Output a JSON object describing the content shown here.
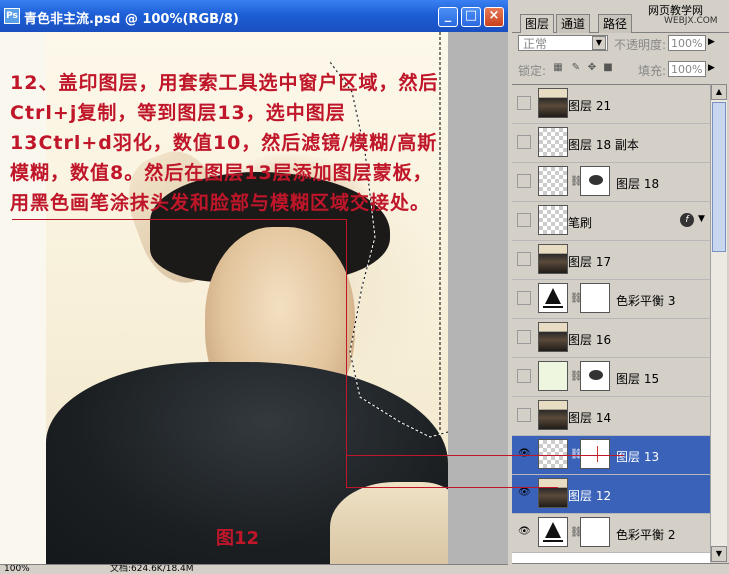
{
  "document": {
    "title": "青色非主流.psd @ 100%(RGB/8)",
    "icon": "ps-document-icon",
    "zoom": "100%",
    "doc_size": "文档:624.6K/18.4M",
    "instruction": "12、盖印图层，用套索工具选中窗户区域，然后Ctrl+j复制，等到图层13，选中图层13Ctrl+d羽化，数值10，然后滤镜/模糊/高斯模糊，数值8。然后在图层13层添加图层蒙板，用黑色画笔涂抹头发和脸部与模糊区域交接处。",
    "figure_label": "图12",
    "annotation_color": "#c0162a"
  },
  "panel": {
    "tabs": [
      "图层",
      "通道",
      "路径"
    ],
    "watermark": "网页教学网",
    "watermark_sub": "WEBJX.COM",
    "blend_mode": "正常",
    "opacity_label": "不透明度:",
    "opacity_value": "100%",
    "lock_label": "锁定:",
    "fill_label": "填充:",
    "fill_value": "100%",
    "selected_color": "#3a62b8",
    "layers": [
      {
        "name": "图层 21",
        "visible": false,
        "thumb": "photo",
        "selected": false
      },
      {
        "name": "图层 18 副本",
        "visible": false,
        "thumb": "transparent",
        "selected": false
      },
      {
        "name": "图层 18",
        "visible": false,
        "thumb": "transparent",
        "mask": "smudge",
        "selected": false
      },
      {
        "name": "笔刷",
        "visible": false,
        "thumb": "transparent",
        "fx": true,
        "selected": false
      },
      {
        "name": "图层 17",
        "visible": false,
        "thumb": "photo",
        "selected": false
      },
      {
        "name": "色彩平衡 3",
        "visible": false,
        "thumb": "balance",
        "mask": "white",
        "selected": false
      },
      {
        "name": "图层 16",
        "visible": false,
        "thumb": "photo",
        "selected": false
      },
      {
        "name": "图层 15",
        "visible": false,
        "thumb": "light",
        "mask": "smudge",
        "selected": false
      },
      {
        "name": "图层 14",
        "visible": false,
        "thumb": "photo",
        "selected": false
      },
      {
        "name": "图层 13",
        "visible": true,
        "thumb": "transparent",
        "mask": "line",
        "selected": true
      },
      {
        "name": "图层 12",
        "visible": true,
        "thumb": "photo",
        "selected": true
      },
      {
        "name": "色彩平衡 2",
        "visible": true,
        "thumb": "balance",
        "mask": "white",
        "selected": false
      }
    ]
  }
}
